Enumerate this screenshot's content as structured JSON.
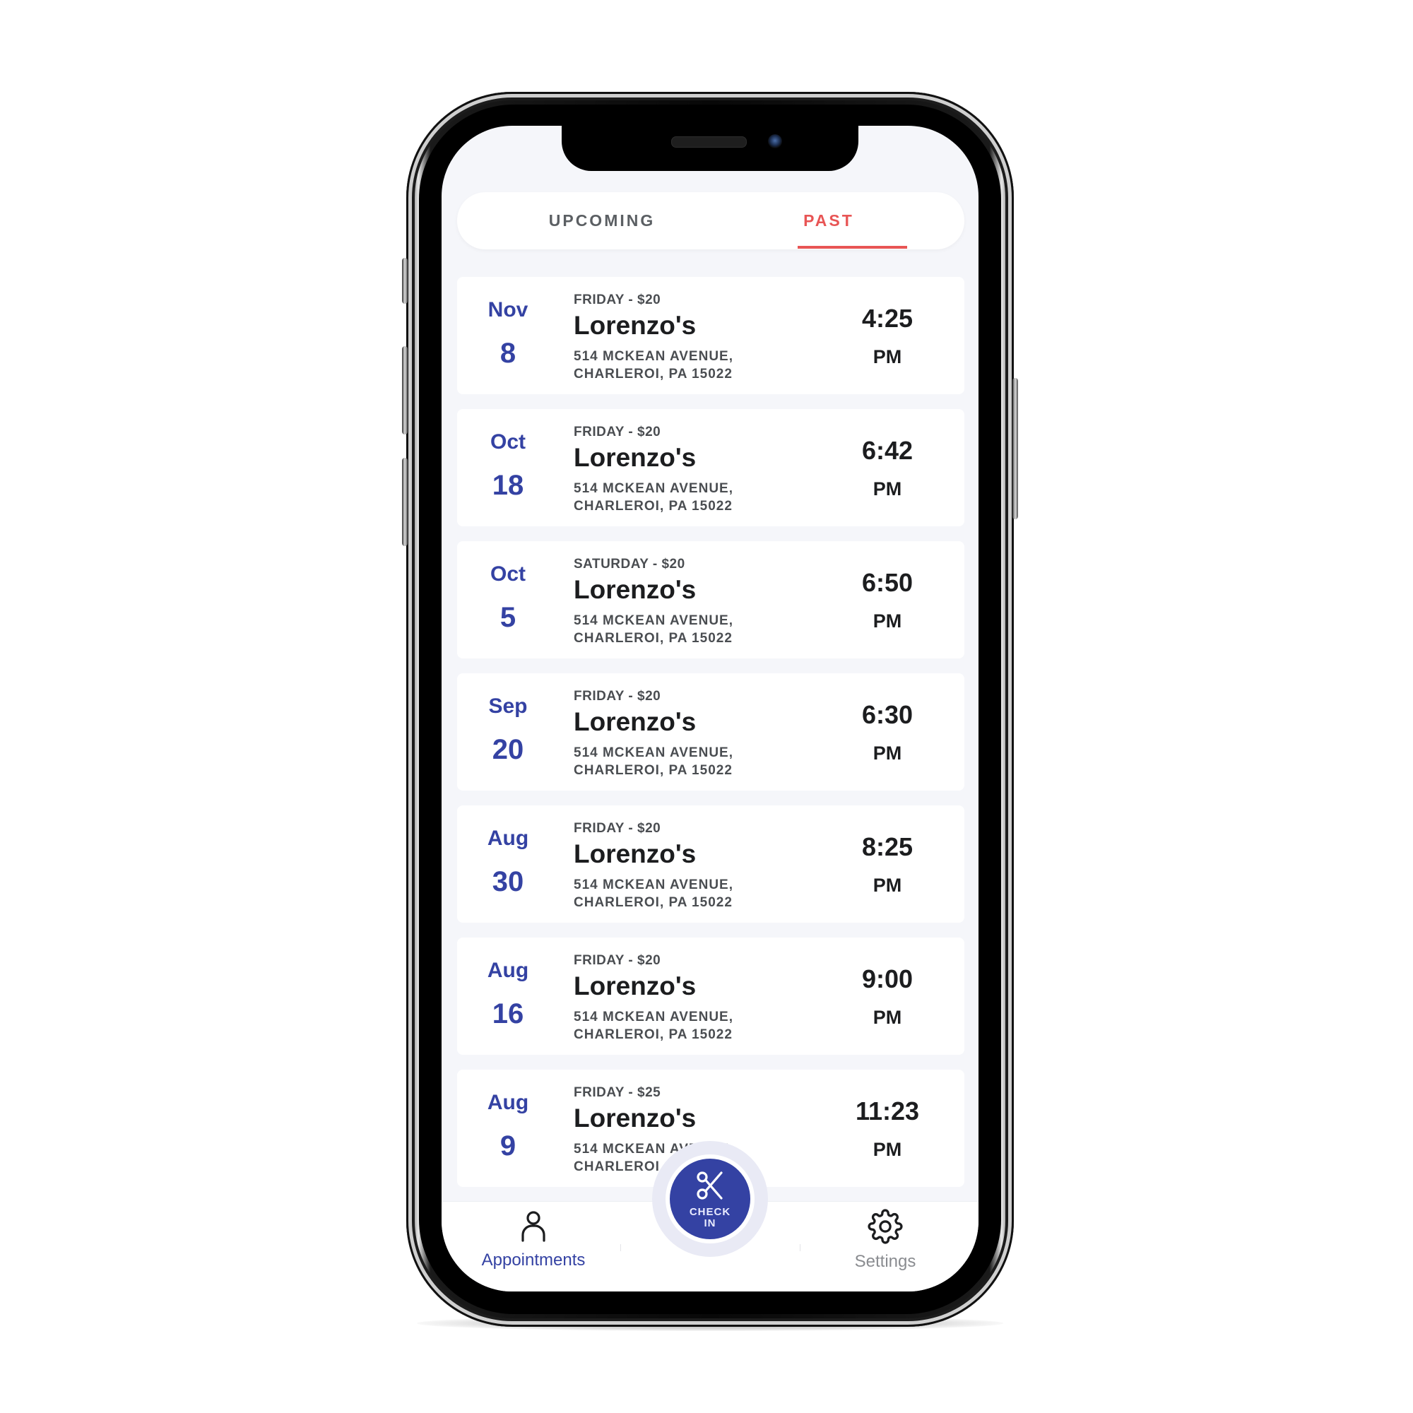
{
  "tabs": [
    {
      "label": "UPCOMING",
      "active": false
    },
    {
      "label": "PAST",
      "active": true
    }
  ],
  "colors": {
    "accent": "#3442a3",
    "active_tab": "#e85555",
    "background": "#f5f6fa"
  },
  "appointments": [
    {
      "month": "Nov",
      "day": "8",
      "meta": "FRIDAY - $20",
      "venue": "Lorenzo's",
      "address_line1": "514 MCKEAN AVENUE,",
      "address_line2": "CHARLEROI, PA 15022",
      "time": "4:25",
      "ampm": "PM"
    },
    {
      "month": "Oct",
      "day": "18",
      "meta": "FRIDAY - $20",
      "venue": "Lorenzo's",
      "address_line1": "514 MCKEAN AVENUE,",
      "address_line2": "CHARLEROI, PA 15022",
      "time": "6:42",
      "ampm": "PM"
    },
    {
      "month": "Oct",
      "day": "5",
      "meta": "SATURDAY - $20",
      "venue": "Lorenzo's",
      "address_line1": "514 MCKEAN AVENUE,",
      "address_line2": "CHARLEROI, PA 15022",
      "time": "6:50",
      "ampm": "PM"
    },
    {
      "month": "Sep",
      "day": "20",
      "meta": "FRIDAY - $20",
      "venue": "Lorenzo's",
      "address_line1": "514 MCKEAN AVENUE,",
      "address_line2": "CHARLEROI, PA 15022",
      "time": "6:30",
      "ampm": "PM"
    },
    {
      "month": "Aug",
      "day": "30",
      "meta": "FRIDAY - $20",
      "venue": "Lorenzo's",
      "address_line1": "514 MCKEAN AVENUE,",
      "address_line2": "CHARLEROI, PA 15022",
      "time": "8:25",
      "ampm": "PM"
    },
    {
      "month": "Aug",
      "day": "16",
      "meta": "FRIDAY - $20",
      "venue": "Lorenzo's",
      "address_line1": "514 MCKEAN AVENUE,",
      "address_line2": "CHARLEROI, PA 15022",
      "time": "9:00",
      "ampm": "PM"
    },
    {
      "month": "Aug",
      "day": "9",
      "meta": "FRIDAY - $25",
      "venue": "Lorenzo's",
      "address_line1": "514 MCKEAN AVENUE,",
      "address_line2": "CHARLEROI, PA 15022",
      "time": "11:23",
      "ampm": "PM"
    }
  ],
  "bottom_nav": {
    "appointments_label": "Appointments",
    "appointments_icon": "person-icon",
    "settings_label": "Settings",
    "settings_icon": "gear-icon",
    "checkin_line1": "CHECK",
    "checkin_line2": "IN",
    "checkin_icon": "scissors-icon"
  }
}
